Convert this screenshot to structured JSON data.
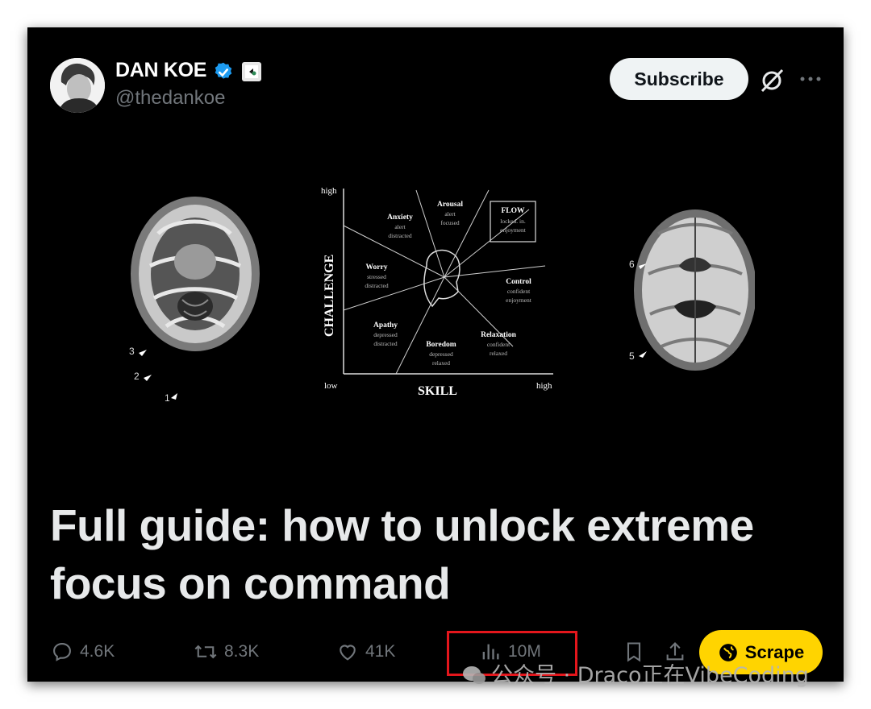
{
  "author": {
    "name": "DAN KOE",
    "handle": "@thedankoe"
  },
  "header": {
    "subscribe_label": "Subscribe"
  },
  "media": {
    "diagram": {
      "y_axis_label": "CHALLENGE",
      "x_axis_label": "SKILL",
      "y_high": "high",
      "x_low": "low",
      "x_high": "high",
      "regions": [
        {
          "title": "Arousal",
          "lines": [
            "alert",
            "focused"
          ]
        },
        {
          "title": "Anxiety",
          "lines": [
            "alert",
            "distracted"
          ]
        },
        {
          "title": "FLOW",
          "lines": [
            "locked. in.",
            "enjoyment"
          ]
        },
        {
          "title": "Worry",
          "lines": [
            "stressed",
            "distracted"
          ]
        },
        {
          "title": "Control",
          "lines": [
            "confident",
            "enjoyment"
          ]
        },
        {
          "title": "Apathy",
          "lines": [
            "depressed",
            "distracted"
          ]
        },
        {
          "title": "Relaxation",
          "lines": [
            "confident",
            "relaxed"
          ]
        },
        {
          "title": "Boredom",
          "lines": [
            "depressed",
            "relaxed"
          ]
        }
      ]
    },
    "left_scan_markers": [
      "3",
      "2",
      "1"
    ],
    "right_scan_markers": [
      "6",
      "5"
    ]
  },
  "post": {
    "title": "Full guide: how to unlock extreme focus on command"
  },
  "actions": {
    "replies": "4.6K",
    "reposts": "8.3K",
    "likes": "41K",
    "views": "10M",
    "scrape_label": "Scrape"
  },
  "watermark": "公众号 · Draco正在VibeCoding",
  "colors": {
    "background": "#000000",
    "text": "#e7e9ea",
    "muted": "#71767b",
    "verified": "#1d9bf0",
    "scrape": "#ffd400",
    "highlight": "#e4161c"
  }
}
